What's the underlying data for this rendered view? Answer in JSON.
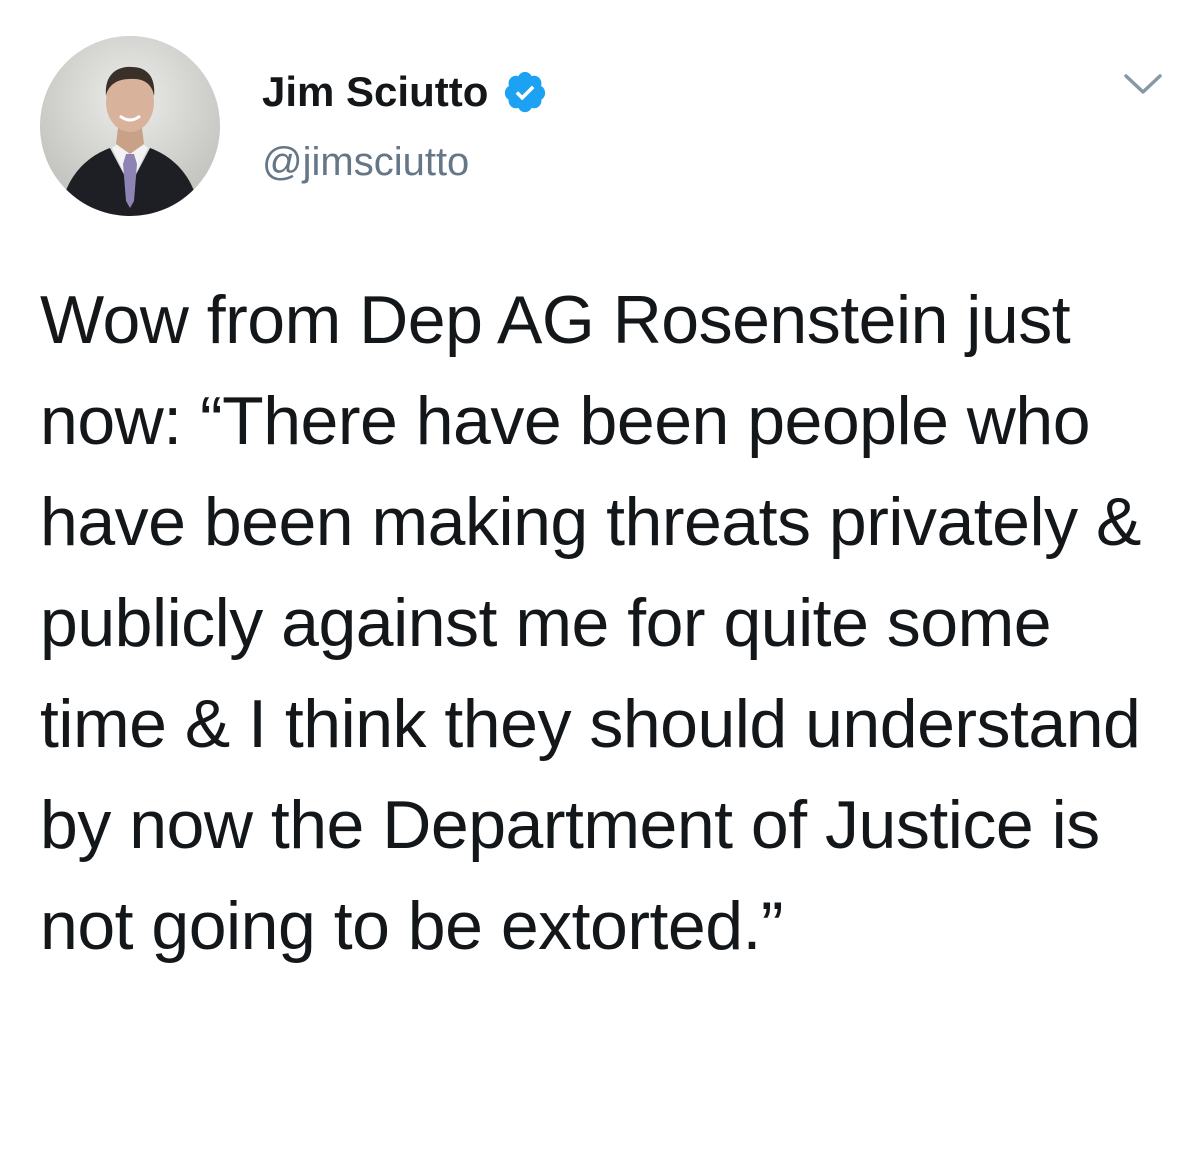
{
  "author": {
    "display_name": "Jim Sciutto",
    "handle": "@jimsciutto",
    "verified": true,
    "avatar_icon": "profile-photo"
  },
  "menu": {
    "icon": "chevron-down-icon"
  },
  "tweet": {
    "text": "Wow from Dep AG Rosenstein just now: “There have been people who have been making threats privately & publicly against me for quite some time & I think they should understand by now the Department of Justice is not going to be extorted.”"
  },
  "colors": {
    "text": "#14171a",
    "secondary": "#657786",
    "verified_blue": "#1da1f2",
    "background": "#ffffff"
  }
}
